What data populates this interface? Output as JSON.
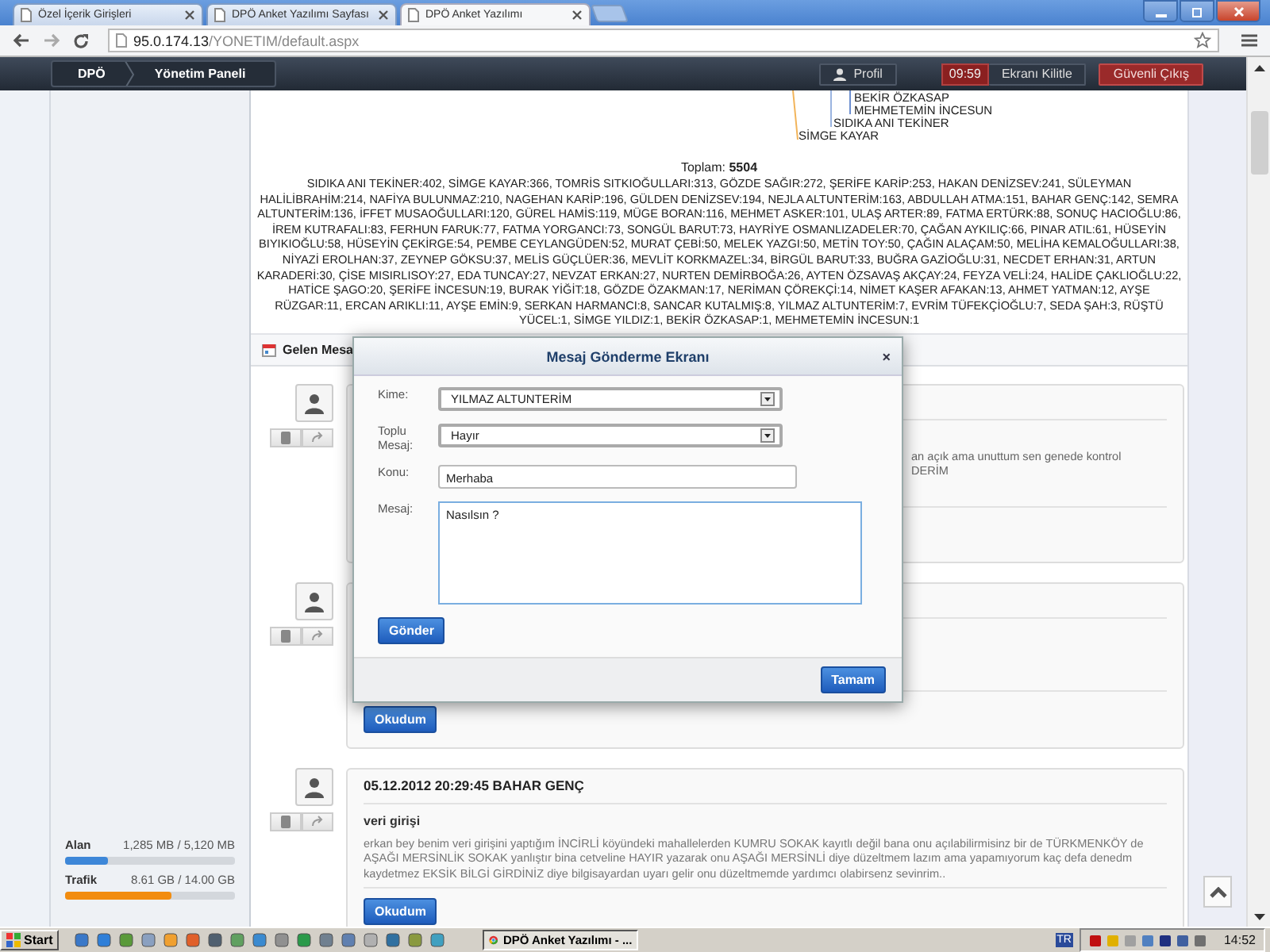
{
  "browser": {
    "tabs": [
      {
        "title": "Özel İçerik Girişleri",
        "selected": false
      },
      {
        "title": "DPÖ Anket Yazılımı Sayfası",
        "selected": false
      },
      {
        "title": "DPÖ Anket Yazılımı",
        "selected": true
      }
    ],
    "address": {
      "host": "95.0.174.13",
      "path": "/YONETIM/default.aspx"
    }
  },
  "navbar": {
    "breadcrumb": [
      "DPÖ",
      "Yönetim Paneli"
    ],
    "profile": "Profil",
    "timer": "09:59",
    "lock": "Ekranı Kilitle",
    "logout": "Güvenli Çıkış"
  },
  "sidebar": {
    "quotas": [
      {
        "label": "Alan",
        "reading": "1,285 MB / 5,120 MB",
        "level": 0.25,
        "color": "#3d87d8"
      },
      {
        "label": "Trafik",
        "reading": "8.61 GB / 14.00 GB",
        "level": 0.63,
        "color": "#f28c0f"
      }
    ]
  },
  "chart_labels": [
    "BEKİR ÖZKASAP",
    "MEHMETEMİN İNCESUN",
    "SIDIKA ANI TEKİNER",
    "SİMGE KAYAR"
  ],
  "total": "Toplam: **5504**",
  "distribution": "SIDIKA ANI TEKİNER:402, SİMGE KAYAR:366, TOMRİS SITKIOĞULLARI:313, GÖZDE SAĞIR:272, ŞERİFE KARİP:253, HAKAN DENİZSEV:241, SÜLEYMAN HALİLİBRAHİM:214, NAFİYA BULUNMAZ:210, NAGEHAN KARİP:196, GÜLDEN DENİZSEV:194, NEJLA ALTUNTERİM:163, ABDULLAH ATMA:151, BAHAR GENÇ:142, SEMRA ALTUNTERİM:136, İFFET MUSAOĞULLARI:120, GÜREL HAMİS:119, MÜGE BORAN:116, MEHMET ASKER:101, ULAŞ ARTER:89, FATMA ERTÜRK:88, SONUÇ HACIOĞLU:86, İREM KUTRAFALI:83, FERHUN FARUK:77, FATMA YORGANCI:73, SONGÜL BARUT:73, HAYRİYE OSMANLIZADELER:70, ÇAĞAN AYKILIÇ:66, PINAR ATIL:61, HÜSEYİN BIYIKIOĞLU:58, HÜSEYİN ÇEKİRGE:54, PEMBE CEYLANGÜDEN:52, MURAT ÇEBİ:50, MELEK YAZGI:50, METİN TOY:50, ÇAĞIN ALAÇAM:50, MELİHA KEMALOĞULLARI:38, NİYAZİ EROLHAN:37, ZEYNEP GÖKSU:37, MELİS GÜÇLÜER:36, MEVLİT KORKMAZEL:34, BİRGÜL BARUT:33, BUĞRA GAZİOĞLU:31, NECDET ERHAN:31, ARTUN KARADERİ:30, ÇİSE MISIRLISOY:27, EDA TUNCAY:27, NEVZAT ERKAN:27, NURTEN DEMİRBOĞA:26, AYTEN ÖZSAVAŞ AKÇAY:24, FEYZA VELİ:24, HALİDE ÇAKLIOĞLU:22, HATİCE ŞAGO:20, ŞERİFE İNCESUN:19, BURAK YİĞİT:18, GÖZDE ÖZAKMAN:17, NERİMAN ÇÖREKÇİ:14, NİMET KAŞER AFAKAN:13, AHMET YATMAN:12, AYŞE RÜZGAR:11, ERCAN ARIKLI:11, AYŞE EMİN:9, SERKAN HARMANCI:8, SANCAR KUTALMIŞ:8, YILMAZ ALTUNTERİM:7, EVRİM TÜFEKÇİOĞLU:7, SEDA ŞAH:3, RÜŞTÜ YÜCEL:1, SİMGE YILDIZ:1, BEKİR ÖZKASAP:1, MEHMETEMİN İNCESUN:1",
  "inbox": {
    "title": "Gelen Mesa"
  },
  "messages": [
    {
      "kind": "covered",
      "fragments": [
        "an açık ama unuttum sen genede kontrol",
        "DERİM"
      ]
    },
    {
      "kind": "covered",
      "button": "Okudum"
    },
    {
      "kind": "full",
      "header": "05.12.2012 20:29:45 BAHAR GENÇ",
      "subject": "veri girişi",
      "body": "erkan bey benim veri girişini yaptığım İNCİRLİ köyündeki mahallelerden KUMRU SOKAK kayıtlı değil bana onu açılabilirmisinz bir de TÜRKMENKÖY de AŞAĞI MERSİNLİK SOKAK yanlıştır bina cetveline HAYIR yazarak onu AŞAĞI MERSİNLİ diye düzeltmem lazım ama yapamıyorum kaç defa denedm kaydetmez EKSİK BİLGİ GİRDİNİZ diye bilgisayardan uyarı gelir onu düzeltmemde yardımcı olabirsenz sevinrim..",
      "button": "Okudum"
    }
  ],
  "modal": {
    "title": "Mesaj Gönderme Ekranı",
    "close": "×",
    "fields": [
      {
        "kind": "select",
        "label": "Kime:",
        "value": "YILMAZ ALTUNTERİM"
      },
      {
        "kind": "select",
        "label": "Toplu Mesaj:",
        "value": "Hayır"
      },
      {
        "kind": "input",
        "label": "Konu:",
        "value": "Merhaba"
      },
      {
        "kind": "textarea",
        "label": "Mesaj:",
        "value": "Nasılsın ?"
      }
    ],
    "send": "Gönder",
    "ok": "Tamam"
  },
  "taskbar": {
    "start": "Start",
    "task": "DPÖ Anket Yazılımı - ...",
    "language": "TR",
    "clock": "14:52"
  }
}
